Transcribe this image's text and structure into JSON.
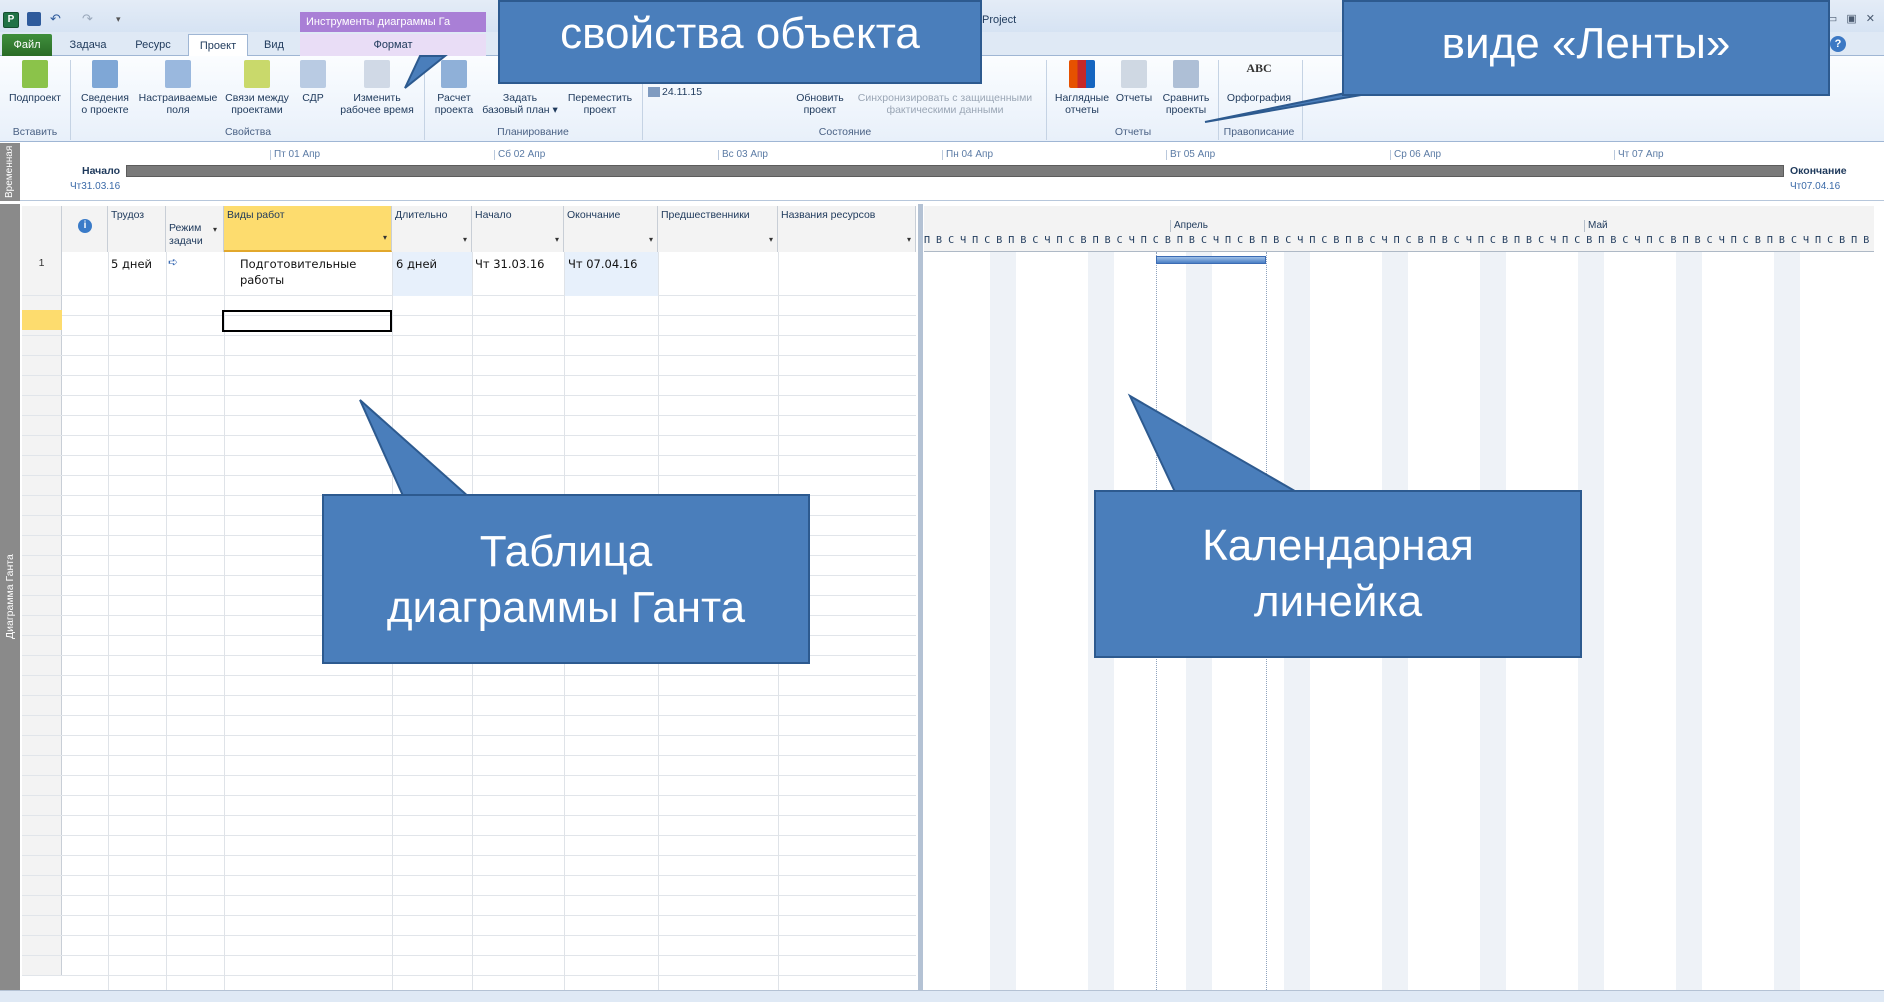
{
  "window": {
    "context_tab_header": "Инструменты диаграммы Га",
    "title_fragment": "Project",
    "controls": "▭ ▣ ✕"
  },
  "tabs": [
    {
      "label": "Файл"
    },
    {
      "label": "Задача"
    },
    {
      "label": "Ресурс"
    },
    {
      "label": "Проект"
    },
    {
      "label": "Вид"
    },
    {
      "label": "Формат"
    }
  ],
  "ribbon": {
    "insert": {
      "subproject": "Подпроект",
      "group_label": "Вставить"
    },
    "properties": {
      "project_info": "Сведения\nо проекте",
      "custom_fields": "Настраиваемые\nполя",
      "links": "Связи между\nпроектами",
      "wbs": "СДР",
      "working_time": "Изменить\nрабочее время",
      "group_label": "Свойства"
    },
    "schedule": {
      "calculate": "Расчет\nпроекта",
      "baseline": "Задать\nбазовый план ▾",
      "move": "Переместить\nпроект",
      "group_label": "Планирование"
    },
    "status": {
      "date": "24.11.15",
      "update": "Обновить\nпроект",
      "sync": "Синхронизировать с защищенными\nфактическими данными",
      "group_label": "Состояние"
    },
    "reports": {
      "visual": "Наглядные\nотчеты",
      "reports": "Отчеты",
      "compare": "Сравнить\nпроекты",
      "group_label": "Отчеты"
    },
    "proofing": {
      "abc": "ABC",
      "spelling": "Орфография",
      "group_label": "Правописание"
    }
  },
  "timeline": {
    "side_label": "Временная",
    "ticks": [
      "Пт 01 Апр",
      "Сб 02 Апр",
      "Вс 03 Апр",
      "Пн 04 Апр",
      "Вт 05 Апр",
      "Ср 06 Апр",
      "Чт 07 Апр"
    ],
    "start_label": "Начало",
    "start_date": "Чт31.03.16",
    "end_label": "Окончание",
    "end_date": "Чт07.04.16"
  },
  "viewbar_label": "Диаграмма Ганта",
  "table": {
    "columns": [
      {
        "label": "Трудоз"
      },
      {
        "label": "Режим\nзадачи"
      },
      {
        "label": "Виды работ"
      },
      {
        "label": "Длительно"
      },
      {
        "label": "Начало"
      },
      {
        "label": "Окончание"
      },
      {
        "label": "Предшественники"
      },
      {
        "label": "Названия ресурсов"
      }
    ],
    "rows": [
      {
        "num": "1",
        "work": "5 дней",
        "name": "Подготовительные\nработы",
        "duration": "6 дней",
        "start": "Чт 31.03.16",
        "finish": "Чт 07.04.16"
      }
    ]
  },
  "gantt": {
    "months": [
      "Апрель",
      "Май"
    ],
    "days": "П В С Ч П С В П В С Ч П С В П В С Ч П С В П В С Ч П С В П В С Ч П С В П В С Ч П С В П В С Ч П С В П В С Ч П С В П В С Ч П С В П В С Ч П С В П В С Ч П С В П В С Ч П С В П В С Ч П С В П В С Ч П С В П В С Ч П С В П В С Ч П С"
  },
  "callouts": {
    "object_props": "свойства объекта",
    "ribbon_view": "виде «Ленты»",
    "gantt_table": "Таблица\nдиаграммы Ганта",
    "calendar_ruler": "Календарная\nлинейка"
  },
  "colors": {
    "callout_fill": "#4a7ebb",
    "file_tab": "#2e7d32",
    "context_tab": "#a97fd6",
    "selected_header": "#fddc6e",
    "task_bar": "#4a7fc4"
  }
}
